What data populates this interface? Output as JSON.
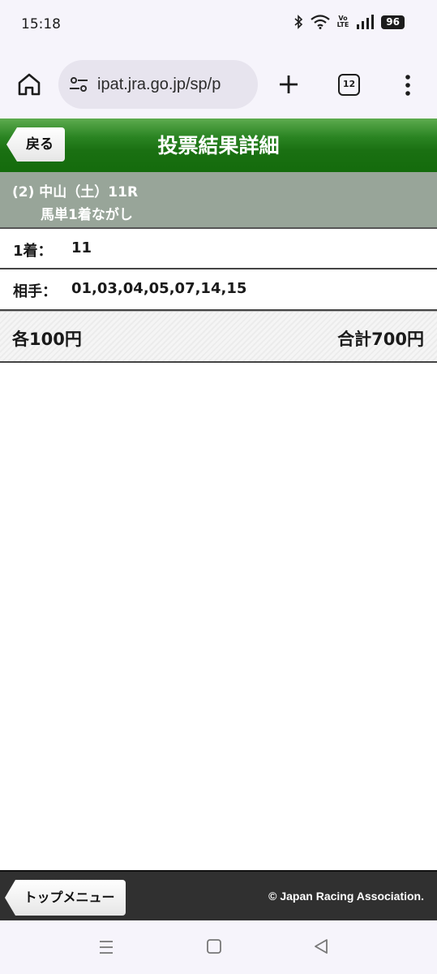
{
  "status_bar": {
    "time": "15:18",
    "volte_top": "Vo",
    "volte_bottom": "LTE",
    "battery": "96"
  },
  "browser": {
    "url": "ipat.jra.go.jp/sp/p",
    "tab_count": "12"
  },
  "header": {
    "back_label": "戻る",
    "title": "投票結果詳細",
    "gradient_color": "#1a7012"
  },
  "race": {
    "line1": "(2) 中山（土）11R",
    "line2": "馬単1着ながし"
  },
  "rows": {
    "first_label": "1着：",
    "first_value": "11",
    "partner_label": "相手：",
    "partner_value": "01,03,04,05,07,14,15"
  },
  "totals": {
    "each": "各100円",
    "sum": "合計700円"
  },
  "footer": {
    "top_menu_label": "トップメニュー",
    "copyright": "© Japan Racing Association."
  }
}
